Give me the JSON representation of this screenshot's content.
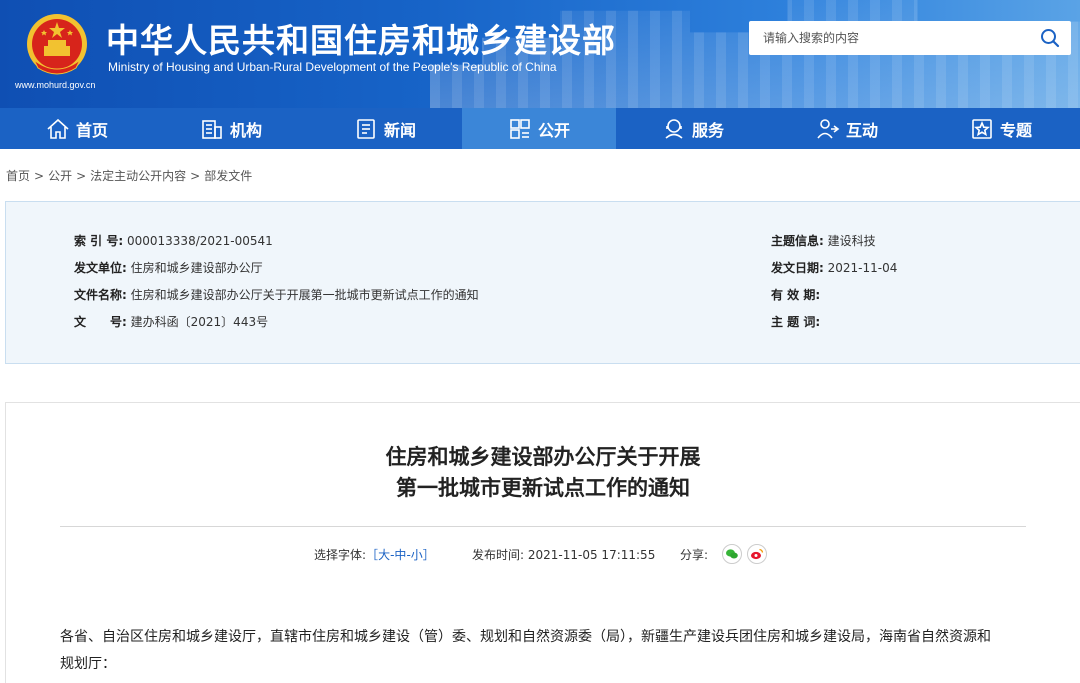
{
  "header": {
    "title": "中华人民共和国住房和城乡建设部",
    "subtitle": "Ministry of Housing and Urban-Rural Development of the People's Republic of China",
    "url": "www.mohurd.gov.cn",
    "search_placeholder": "请输入搜索的内容"
  },
  "nav": {
    "items": [
      {
        "label": "首页",
        "icon": "home-icon"
      },
      {
        "label": "机构",
        "icon": "building-icon"
      },
      {
        "label": "新闻",
        "icon": "news-icon"
      },
      {
        "label": "公开",
        "icon": "open-icon"
      },
      {
        "label": "服务",
        "icon": "service-icon"
      },
      {
        "label": "互动",
        "icon": "interact-icon"
      },
      {
        "label": "专题",
        "icon": "topic-icon"
      }
    ],
    "active": "公开"
  },
  "breadcrumb": [
    "首页",
    "公开",
    "法定主动公开内容",
    "部发文件"
  ],
  "info": {
    "index_label": "索 引 号:",
    "index_value": "000013338/2021-00541",
    "org_label": "发文单位:",
    "org_value": "住房和城乡建设部办公厅",
    "docname_label": "文件名称:",
    "docname_value": "住房和城乡建设部办公厅关于开展第一批城市更新试点工作的通知",
    "docno_label": "文　　号:",
    "docno_value": "建办科函〔2021〕443号",
    "topic_label": "主题信息:",
    "topic_value": "建设科技",
    "date_label": "发文日期:",
    "date_value": "2021-11-04",
    "valid_label": "有 效 期:",
    "valid_value": "",
    "keywords_label": "主 题 词:",
    "keywords_value": ""
  },
  "article": {
    "title_line1": "住房和城乡建设部办公厅关于开展",
    "title_line2": "第一批城市更新试点工作的通知",
    "font_label": "选择字体:",
    "font_open": "［",
    "font_large": "大",
    "font_mid": "中",
    "font_small": "小",
    "font_dash1": "-",
    "font_dash2": "-",
    "font_close": "］",
    "publish_label": "发布时间:",
    "publish_time": "2021-11-05 17:11:55",
    "share_label": "分享:",
    "body_line1": "各省、自治区住房和城乡建设厅，直辖市住房和城乡建设（管）委、规划和自然资源委（局），新疆生产建设兵团住房和城乡建设局，海南省自然资源和",
    "body_line2": "规划厅："
  },
  "colors": {
    "primary": "#1b62c4",
    "active_nav": "#3b86d8",
    "info_bg": "#f0f6fb"
  }
}
